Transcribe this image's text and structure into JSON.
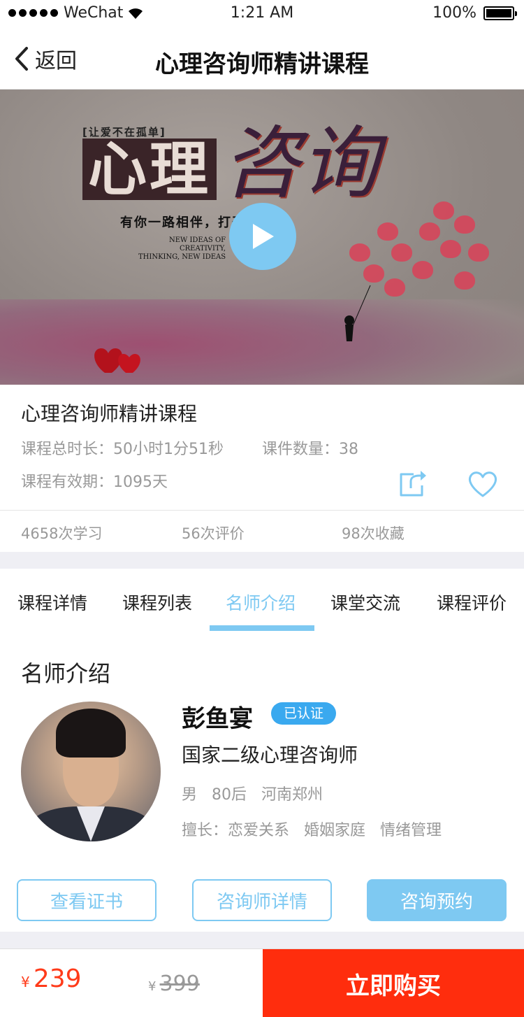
{
  "status_bar": {
    "carrier": "WeChat",
    "time": "1:21 AM",
    "battery": "100%"
  },
  "nav": {
    "back_label": "返回",
    "title": "心理咨询师精讲课程"
  },
  "hero": {
    "tag": "[让爱不在孤单]",
    "big_text_1": "心理",
    "big_text_2": "咨询",
    "slogan": "有你一路相伴，打开心扉",
    "english": [
      "NEW IDEAS OF",
      "CREATIVITY,",
      "THINKING, NEW IDEAS"
    ]
  },
  "course": {
    "title": "心理咨询师精讲课程",
    "duration": "课程总时长：50小时1分51秒",
    "count": "课件数量：38",
    "validity": "课程有效期：1095天"
  },
  "stats": {
    "learn": "4658次学习",
    "reviews": "56次评价",
    "favorites": "98次收藏"
  },
  "tabs": [
    {
      "label": "课程详情"
    },
    {
      "label": "课程列表"
    },
    {
      "label": "名师介绍"
    },
    {
      "label": "课堂交流"
    },
    {
      "label": "课程评价"
    }
  ],
  "teacher": {
    "section_title": "名师介绍",
    "name": "彭鱼宴",
    "badge": "已认证",
    "title": "国家二级心理咨询师",
    "meta": "男   80后   河南郑州",
    "skills": "擅长：恋爱关系   婚姻家庭   情绪管理"
  },
  "buttons": {
    "certificate": "查看证书",
    "detail": "咨询师详情",
    "book": "咨询预约"
  },
  "purchase": {
    "currency": "¥",
    "price": "239",
    "original_price": "399",
    "buy_label": "立即购买",
    "accent": "#ff2d0d"
  },
  "theme": {
    "primary": "#7ec9f2",
    "badge": "#3aa9ef"
  }
}
